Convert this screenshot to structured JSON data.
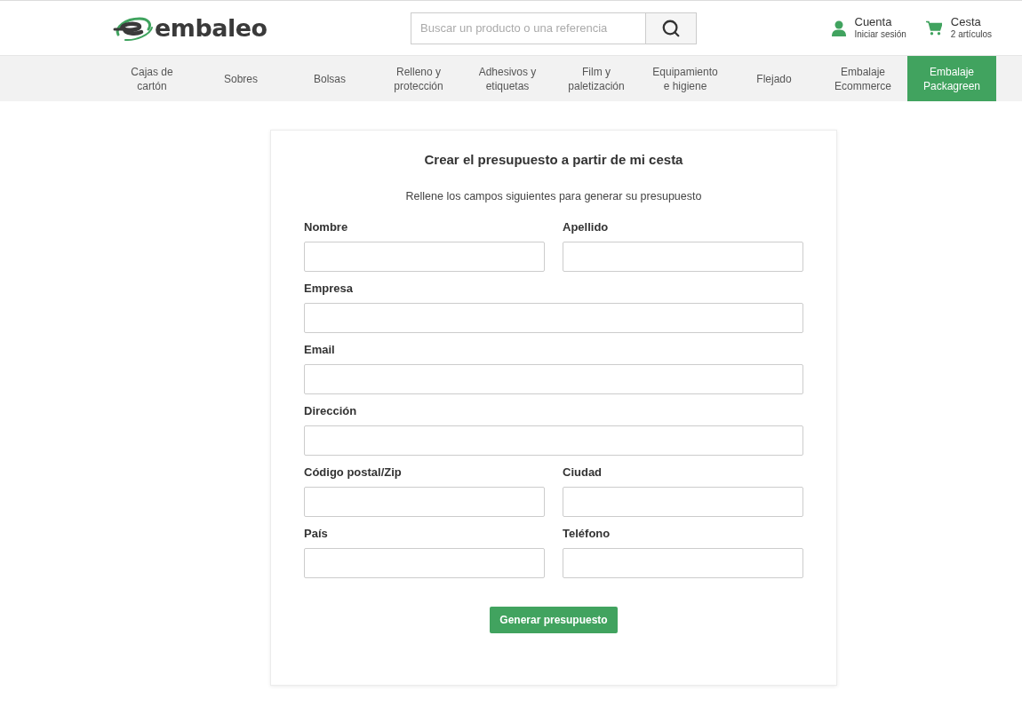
{
  "header": {
    "logo": {
      "text": "embaleo"
    },
    "search": {
      "placeholder": "Buscar un producto o una referencia"
    },
    "account": {
      "title": "Cuenta",
      "subtitle": "Iniciar sesión"
    },
    "cart": {
      "title": "Cesta",
      "subtitle": "2 artículos"
    }
  },
  "nav": [
    {
      "label": "Cajas de cartón",
      "selected": false
    },
    {
      "label": "Sobres",
      "selected": false
    },
    {
      "label": "Bolsas",
      "selected": false
    },
    {
      "label": "Relleno y protección",
      "selected": false
    },
    {
      "label": "Adhesivos y etiquetas",
      "selected": false
    },
    {
      "label": "Film y paletización",
      "selected": false
    },
    {
      "label": "Equipamiento e higiene",
      "selected": false
    },
    {
      "label": "Flejado",
      "selected": false
    },
    {
      "label": "Embalaje Ecommerce",
      "selected": false
    },
    {
      "label": "Embalaje Packagreen",
      "selected": true
    }
  ],
  "form": {
    "title": "Crear el presupuesto a partir de mi cesta",
    "subtitle": "Rellene los campos siguientes para generar su presupuesto",
    "rows": [
      {
        "fields": [
          {
            "label": "Nombre"
          },
          {
            "label": "Apellido"
          }
        ]
      },
      {
        "fields": [
          {
            "label": "Empresa"
          }
        ]
      },
      {
        "fields": [
          {
            "label": "Email"
          }
        ]
      },
      {
        "fields": [
          {
            "label": "Dirección"
          }
        ]
      },
      {
        "fields": [
          {
            "label": "Código postal/Zip"
          },
          {
            "label": "Ciudad"
          }
        ]
      },
      {
        "fields": [
          {
            "label": "País"
          },
          {
            "label": "Teléfono"
          }
        ]
      }
    ],
    "submit": "Generar presupuesto"
  }
}
